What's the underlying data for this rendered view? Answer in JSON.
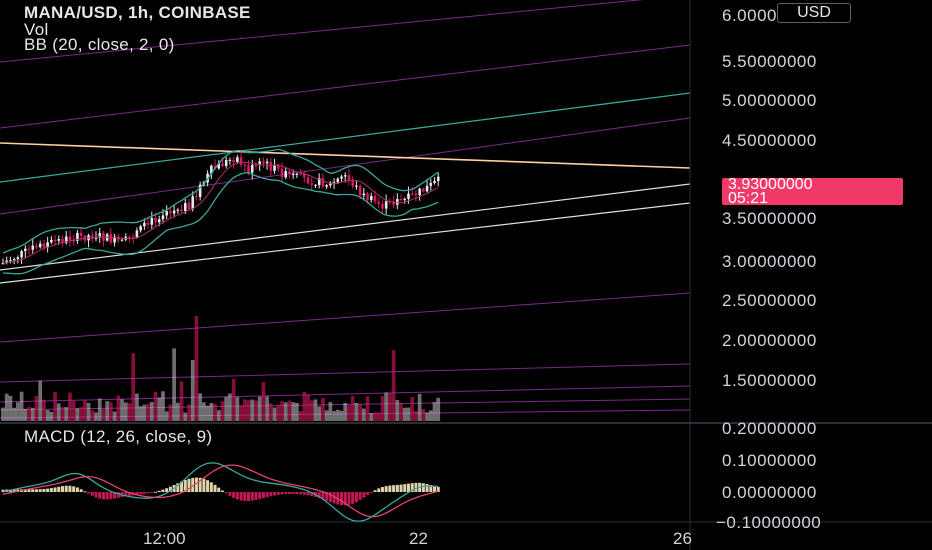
{
  "header": {
    "symbol_line": "MANA/USD, 1h, COINBASE",
    "volume_label": "Vol",
    "bb_label": "BB (20, close, 2, 0)",
    "macd_label": "MACD (12, 26, close, 9)"
  },
  "currency_button": "USD",
  "price_axis": {
    "labels": [
      "6.00000000",
      "5.50000000",
      "5.00000000",
      "4.50000000",
      "3.50000000",
      "3.00000000",
      "2.50000000",
      "2.00000000",
      "1.50000000"
    ],
    "last_price": "3.93000000",
    "countdown": "05:21"
  },
  "macd_axis": {
    "labels": [
      "0.20000000",
      "0.10000000",
      "0.00000000",
      "−0.10000000"
    ]
  },
  "time_axis": {
    "labels": [
      "12:00",
      "22",
      "26"
    ]
  },
  "colors": {
    "background": "#000000",
    "candle_up": "#e9e9e9",
    "candle_down": "#d81b60",
    "bollinger": "#3aa6a0",
    "trendline_orange": "#ffd0a0",
    "support_line": "#e0e0e0",
    "channel_purple": "#7a2a8a",
    "macd_line": "#3aa6a0",
    "signal_line": "#e0466e",
    "last_price_badge": "#f23a6a"
  }
}
